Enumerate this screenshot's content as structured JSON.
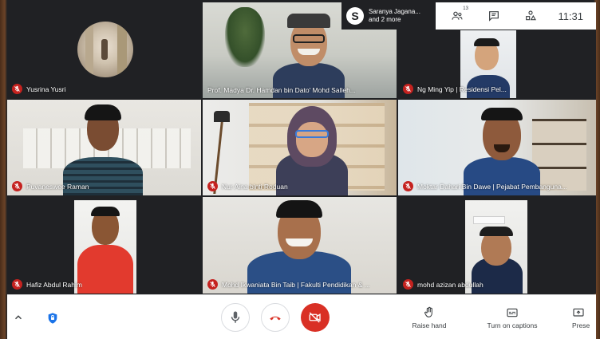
{
  "window": {
    "title": ""
  },
  "presenter": {
    "line1": "Saranya Jagana...",
    "line2": "and 2 more",
    "logo_letter": "S"
  },
  "toolbar": {
    "people_count": "13",
    "clock": "11:31"
  },
  "participants": [
    {
      "name": "Yusrina Yusri",
      "muted": true
    },
    {
      "name": "Prof. Madya Dr. Hamdan bin Dato' Mohd Salleh...",
      "muted": false
    },
    {
      "name": "Ng Ming Yip | Residensi Pel...",
      "muted": true
    },
    {
      "name": "Puvaneswee Raman",
      "muted": true
    },
    {
      "name": "Nur Aina binti Roduan",
      "muted": true
    },
    {
      "name": "Moktar Dahari Bin Dawe | Pejabat Pembanguna...",
      "muted": true
    },
    {
      "name": "Hafiz Abdul Rahim",
      "muted": true
    },
    {
      "name": "Mohd Ikwaniata Bin Taib | Fakulti Pendidikan & ...",
      "muted": true
    },
    {
      "name": "mohd azizan abdullah",
      "muted": true
    }
  ],
  "bottombar": {
    "raise_hand_label": "Raise hand",
    "captions_label": "Turn on captions",
    "present_label": "Prese"
  },
  "colors": {
    "mute_red": "#c5221f",
    "hangup_red": "#d93025",
    "tile_bg": "#202124"
  }
}
